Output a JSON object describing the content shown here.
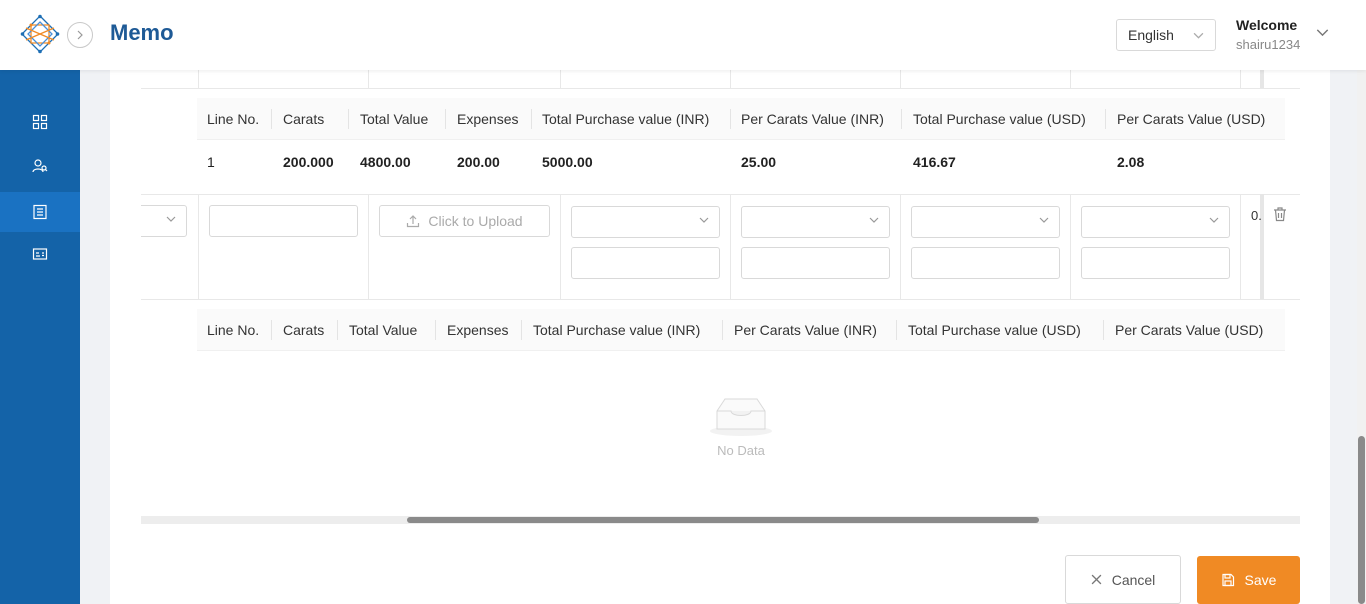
{
  "header": {
    "title": "Memo",
    "language": "English",
    "welcome": "Welcome",
    "username": "shairu1234"
  },
  "sidebar": {
    "items": [
      {
        "icon": "dashboard-grid-icon",
        "active": false
      },
      {
        "icon": "users-search-icon",
        "active": false
      },
      {
        "icon": "list-document-icon",
        "active": true
      },
      {
        "icon": "id-card-icon",
        "active": false
      }
    ]
  },
  "summary_table_1": {
    "columns": [
      "Line No.",
      "Carats",
      "Total Value",
      "Expenses",
      "Total Purchase value (INR)",
      "Per Carats Value (INR)",
      "Total Purchase value (USD)",
      "Per Carats Value (USD)"
    ],
    "rows": [
      [
        "1",
        "200.000",
        "4800.00",
        "200.00",
        "5000.00",
        "25.00",
        "416.67",
        "2.08"
      ]
    ]
  },
  "edit_row": {
    "upload_label": "Click to Upload",
    "truncated_value": "0."
  },
  "summary_table_2": {
    "columns": [
      "Line No.",
      "Carats",
      "Total Value",
      "Expenses",
      "Total Purchase value (INR)",
      "Per Carats Value (INR)",
      "Total Purchase value (USD)",
      "Per Carats Value (USD)"
    ],
    "empty_text": "No Data"
  },
  "actions": {
    "cancel": "Cancel",
    "save": "Save"
  },
  "colors": {
    "brand": "#1463a8",
    "title": "#1e5a96",
    "save": "#f08a24"
  }
}
